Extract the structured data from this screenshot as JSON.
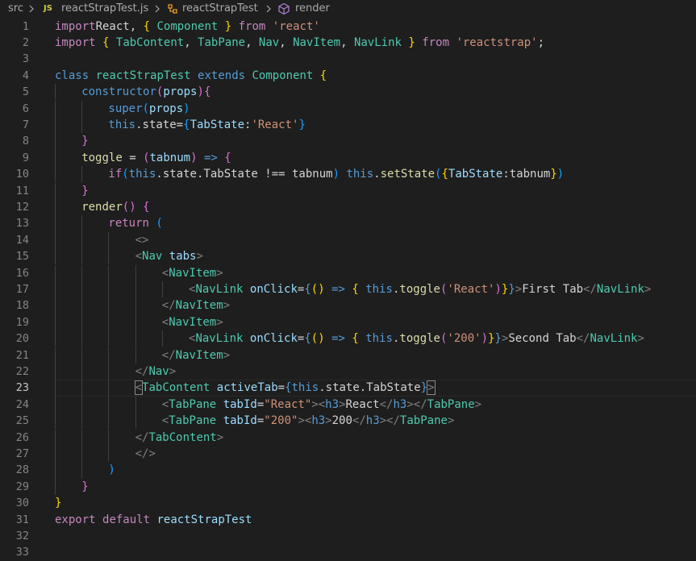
{
  "breadcrumb": {
    "folder": "src",
    "js_badge": "JS",
    "file": "reactStrapTest.js",
    "symbol1": "reactStrapTest",
    "symbol2": "render"
  },
  "editor": {
    "active_line": 23,
    "lines": [
      {
        "n": "1",
        "indent": 0,
        "tokens": [
          [
            "k",
            "import"
          ],
          [
            "",
            "React, "
          ],
          [
            "y",
            "{"
          ],
          [
            "",
            " "
          ],
          [
            "t",
            "Component"
          ],
          [
            "",
            " "
          ],
          [
            "y",
            "}"
          ],
          [
            "",
            " "
          ],
          [
            "k",
            "from"
          ],
          [
            "",
            " "
          ],
          [
            "s",
            "'react'"
          ]
        ]
      },
      {
        "n": "2",
        "indent": 0,
        "tokens": [
          [
            "k",
            "import"
          ],
          [
            "",
            " "
          ],
          [
            "y",
            "{"
          ],
          [
            "",
            " "
          ],
          [
            "t",
            "TabContent"
          ],
          [
            "",
            ", "
          ],
          [
            "t",
            "TabPane"
          ],
          [
            "",
            ", "
          ],
          [
            "t",
            "Nav"
          ],
          [
            "",
            ", "
          ],
          [
            "t",
            "NavItem"
          ],
          [
            "",
            ", "
          ],
          [
            "t",
            "NavLink"
          ],
          [
            "",
            " "
          ],
          [
            "y",
            "}"
          ],
          [
            "",
            " "
          ],
          [
            "k",
            "from"
          ],
          [
            "",
            " "
          ],
          [
            "s",
            "'reactstrap'"
          ],
          [
            "",
            ";"
          ]
        ]
      },
      {
        "n": "3",
        "indent": 0,
        "tokens": []
      },
      {
        "n": "4",
        "indent": 0,
        "tokens": [
          [
            "b",
            "class"
          ],
          [
            "",
            " "
          ],
          [
            "t",
            "reactStrapTest"
          ],
          [
            "",
            " "
          ],
          [
            "b",
            "extends"
          ],
          [
            "",
            " "
          ],
          [
            "t",
            "Component"
          ],
          [
            "",
            " "
          ],
          [
            "y",
            "{"
          ]
        ]
      },
      {
        "n": "5",
        "indent": 1,
        "tokens": [
          [
            "b",
            "constructor"
          ],
          [
            "p",
            "("
          ],
          [
            "v",
            "props"
          ],
          [
            "p",
            ")"
          ],
          [
            "p",
            "{"
          ]
        ]
      },
      {
        "n": "6",
        "indent": 2,
        "tokens": [
          [
            "b",
            "super"
          ],
          [
            "c",
            "("
          ],
          [
            "v",
            "props"
          ],
          [
            "c",
            ")"
          ]
        ]
      },
      {
        "n": "7",
        "indent": 2,
        "tokens": [
          [
            "b",
            "this"
          ],
          [
            "",
            ".state="
          ],
          [
            "c",
            "{"
          ],
          [
            "v",
            "TabState"
          ],
          [
            "",
            ":"
          ],
          [
            "s",
            "'React'"
          ],
          [
            "c",
            "}"
          ]
        ]
      },
      {
        "n": "8",
        "indent": 1,
        "tokens": [
          [
            "p",
            "}"
          ]
        ]
      },
      {
        "n": "9",
        "indent": 1,
        "tokens": [
          [
            "f",
            "toggle"
          ],
          [
            "",
            " = "
          ],
          [
            "p",
            "("
          ],
          [
            "v",
            "tabnum"
          ],
          [
            "p",
            ")"
          ],
          [
            "",
            " "
          ],
          [
            "b",
            "=>"
          ],
          [
            "",
            " "
          ],
          [
            "p",
            "{"
          ]
        ]
      },
      {
        "n": "10",
        "indent": 2,
        "tokens": [
          [
            "k",
            "if"
          ],
          [
            "c",
            "("
          ],
          [
            "b",
            "this"
          ],
          [
            "",
            ".state.TabState !== tabnum"
          ],
          [
            "c",
            ")"
          ],
          [
            "",
            " "
          ],
          [
            "b",
            "this"
          ],
          [
            "",
            "."
          ],
          [
            "f",
            "setState"
          ],
          [
            "c",
            "("
          ],
          [
            "y",
            "{"
          ],
          [
            "v",
            "TabState"
          ],
          [
            "",
            ":tabnum"
          ],
          [
            "y",
            "}"
          ],
          [
            "c",
            ")"
          ]
        ]
      },
      {
        "n": "11",
        "indent": 1,
        "tokens": [
          [
            "p",
            "}"
          ]
        ]
      },
      {
        "n": "12",
        "indent": 1,
        "tokens": [
          [
            "f",
            "render"
          ],
          [
            "p",
            "()"
          ],
          [
            "",
            " "
          ],
          [
            "p",
            "{"
          ]
        ]
      },
      {
        "n": "13",
        "indent": 2,
        "tokens": [
          [
            "k",
            "return"
          ],
          [
            "",
            " "
          ],
          [
            "c",
            "("
          ]
        ]
      },
      {
        "n": "14",
        "indent": 3,
        "tokens": [
          [
            "tag",
            "<>"
          ]
        ]
      },
      {
        "n": "15",
        "indent": 3,
        "tokens": [
          [
            "tag",
            "<"
          ],
          [
            "t",
            "Nav"
          ],
          [
            "",
            " "
          ],
          [
            "v",
            "tabs"
          ],
          [
            "tag",
            ">"
          ]
        ]
      },
      {
        "n": "16",
        "indent": 4,
        "tokens": [
          [
            "tag",
            "<"
          ],
          [
            "t",
            "NavItem"
          ],
          [
            "tag",
            ">"
          ]
        ]
      },
      {
        "n": "17",
        "indent": 5,
        "tokens": [
          [
            "tag",
            "<"
          ],
          [
            "t",
            "NavLink"
          ],
          [
            "",
            " "
          ],
          [
            "v",
            "onClick"
          ],
          [
            "",
            "="
          ],
          [
            "b",
            "{"
          ],
          [
            "y",
            "()"
          ],
          [
            "",
            " "
          ],
          [
            "b",
            "=>"
          ],
          [
            "",
            " "
          ],
          [
            "y",
            "{"
          ],
          [
            "",
            " "
          ],
          [
            "b",
            "this"
          ],
          [
            "",
            "."
          ],
          [
            "f",
            "toggle"
          ],
          [
            "p",
            "("
          ],
          [
            "s",
            "'React'"
          ],
          [
            "p",
            ")"
          ],
          [
            "y",
            "}"
          ],
          [
            "b",
            "}"
          ],
          [
            "tag",
            ">"
          ],
          [
            "",
            "First Tab"
          ],
          [
            "tag",
            "</"
          ],
          [
            "t",
            "NavLink"
          ],
          [
            "tag",
            ">"
          ]
        ]
      },
      {
        "n": "18",
        "indent": 4,
        "tokens": [
          [
            "tag",
            "</"
          ],
          [
            "t",
            "NavItem"
          ],
          [
            "tag",
            ">"
          ]
        ]
      },
      {
        "n": "19",
        "indent": 4,
        "tokens": [
          [
            "tag",
            "<"
          ],
          [
            "t",
            "NavItem"
          ],
          [
            "tag",
            ">"
          ]
        ]
      },
      {
        "n": "20",
        "indent": 5,
        "tokens": [
          [
            "tag",
            "<"
          ],
          [
            "t",
            "NavLink"
          ],
          [
            "",
            " "
          ],
          [
            "v",
            "onClick"
          ],
          [
            "",
            "="
          ],
          [
            "b",
            "{"
          ],
          [
            "y",
            "()"
          ],
          [
            "",
            " "
          ],
          [
            "b",
            "=>"
          ],
          [
            "",
            " "
          ],
          [
            "y",
            "{"
          ],
          [
            "",
            " "
          ],
          [
            "b",
            "this"
          ],
          [
            "",
            "."
          ],
          [
            "f",
            "toggle"
          ],
          [
            "p",
            "("
          ],
          [
            "s",
            "'200'"
          ],
          [
            "p",
            ")"
          ],
          [
            "y",
            "}"
          ],
          [
            "b",
            "}"
          ],
          [
            "tag",
            ">"
          ],
          [
            "",
            "Second Tab"
          ],
          [
            "tag",
            "</"
          ],
          [
            "t",
            "NavLink"
          ],
          [
            "tag",
            ">"
          ]
        ]
      },
      {
        "n": "21",
        "indent": 4,
        "tokens": [
          [
            "tag",
            "</"
          ],
          [
            "t",
            "NavItem"
          ],
          [
            "tag",
            ">"
          ]
        ]
      },
      {
        "n": "22",
        "indent": 3,
        "tokens": [
          [
            "tag",
            "</"
          ],
          [
            "t",
            "Nav"
          ],
          [
            "tag",
            ">"
          ]
        ]
      },
      {
        "n": "23",
        "indent": 3,
        "tokens": [
          [
            "tag bm",
            "<"
          ],
          [
            "t",
            "TabContent"
          ],
          [
            "",
            " "
          ],
          [
            "v",
            "activeTab"
          ],
          [
            "",
            "="
          ],
          [
            "b",
            "{"
          ],
          [
            "b",
            "this"
          ],
          [
            "",
            ".state.TabState"
          ],
          [
            "b",
            "}"
          ],
          [
            "tag bm",
            ">"
          ]
        ]
      },
      {
        "n": "24",
        "indent": 4,
        "tokens": [
          [
            "tag",
            "<"
          ],
          [
            "t",
            "TabPane"
          ],
          [
            "",
            " "
          ],
          [
            "v",
            "tabId"
          ],
          [
            "",
            "="
          ],
          [
            "s",
            "\"React\""
          ],
          [
            "tag",
            ">"
          ],
          [
            "tag",
            "<"
          ],
          [
            "b",
            "h3"
          ],
          [
            "tag",
            ">"
          ],
          [
            "",
            "React"
          ],
          [
            "tag",
            "</"
          ],
          [
            "b",
            "h3"
          ],
          [
            "tag",
            "></"
          ],
          [
            "t",
            "TabPane"
          ],
          [
            "tag",
            ">"
          ]
        ]
      },
      {
        "n": "25",
        "indent": 4,
        "tokens": [
          [
            "tag",
            "<"
          ],
          [
            "t",
            "TabPane"
          ],
          [
            "",
            " "
          ],
          [
            "v",
            "tabId"
          ],
          [
            "",
            "="
          ],
          [
            "s",
            "\"200\""
          ],
          [
            "tag",
            ">"
          ],
          [
            "tag",
            "<"
          ],
          [
            "b",
            "h3"
          ],
          [
            "tag",
            ">"
          ],
          [
            "",
            "200"
          ],
          [
            "tag",
            "</"
          ],
          [
            "b",
            "h3"
          ],
          [
            "tag",
            "></"
          ],
          [
            "t",
            "TabPane"
          ],
          [
            "tag",
            ">"
          ]
        ]
      },
      {
        "n": "26",
        "indent": 3,
        "tokens": [
          [
            "tag",
            "</"
          ],
          [
            "t",
            "TabContent"
          ],
          [
            "tag",
            ">"
          ]
        ]
      },
      {
        "n": "27",
        "indent": 3,
        "tokens": [
          [
            "tag",
            "</>"
          ]
        ]
      },
      {
        "n": "28",
        "indent": 2,
        "tokens": [
          [
            "c",
            ")"
          ]
        ]
      },
      {
        "n": "29",
        "indent": 1,
        "tokens": [
          [
            "p",
            "}"
          ]
        ]
      },
      {
        "n": "30",
        "indent": 0,
        "tokens": [
          [
            "y",
            "}"
          ]
        ]
      },
      {
        "n": "31",
        "indent": 0,
        "tokens": [
          [
            "k",
            "export"
          ],
          [
            "",
            " "
          ],
          [
            "k",
            "default"
          ],
          [
            "",
            " "
          ],
          [
            "v",
            "reactStrapTest"
          ]
        ]
      },
      {
        "n": "32",
        "indent": 0,
        "tokens": []
      },
      {
        "n": "33",
        "indent": 0,
        "tokens": []
      }
    ]
  }
}
